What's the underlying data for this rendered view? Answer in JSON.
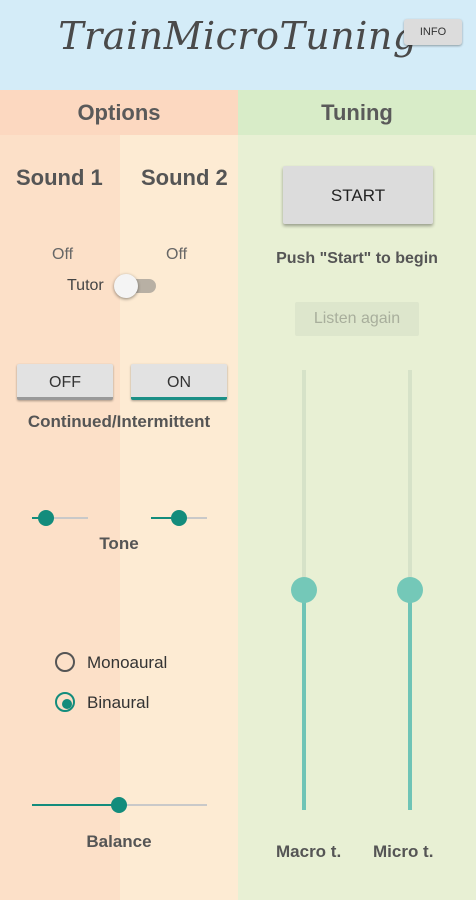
{
  "header": {
    "title": "TrainMicroTuning",
    "info_label": "INFO"
  },
  "options": {
    "heading": "Options",
    "sound1_label": "Sound 1",
    "sound2_label": "Sound 2",
    "tutor": {
      "left_state": "Off",
      "right_state": "Off",
      "label": "Tutor",
      "on": false
    },
    "off_button": "OFF",
    "on_button": "ON",
    "mode_label": "Continued/Intermittent",
    "tone": {
      "label": "Tone",
      "sound1_value": 0.25,
      "sound2_value": 0.5
    },
    "channel": {
      "mono_label": "Monoaural",
      "bin_label": "Binaural",
      "selected": "Binaural"
    },
    "balance": {
      "label": "Balance",
      "value": 0.5
    }
  },
  "tuning": {
    "heading": "Tuning",
    "start_button": "START",
    "hint": "Push \"Start\" to begin",
    "listen_again": "Listen again",
    "macro": {
      "label": "Macro t.",
      "value": 0.5
    },
    "micro": {
      "label": "Micro t.",
      "value": 0.5
    }
  },
  "colors": {
    "accent": "#138c7c",
    "header_bg": "#d4ecf8",
    "options_bg": "#fce0c8",
    "tuning_bg": "#e8f0d4"
  }
}
